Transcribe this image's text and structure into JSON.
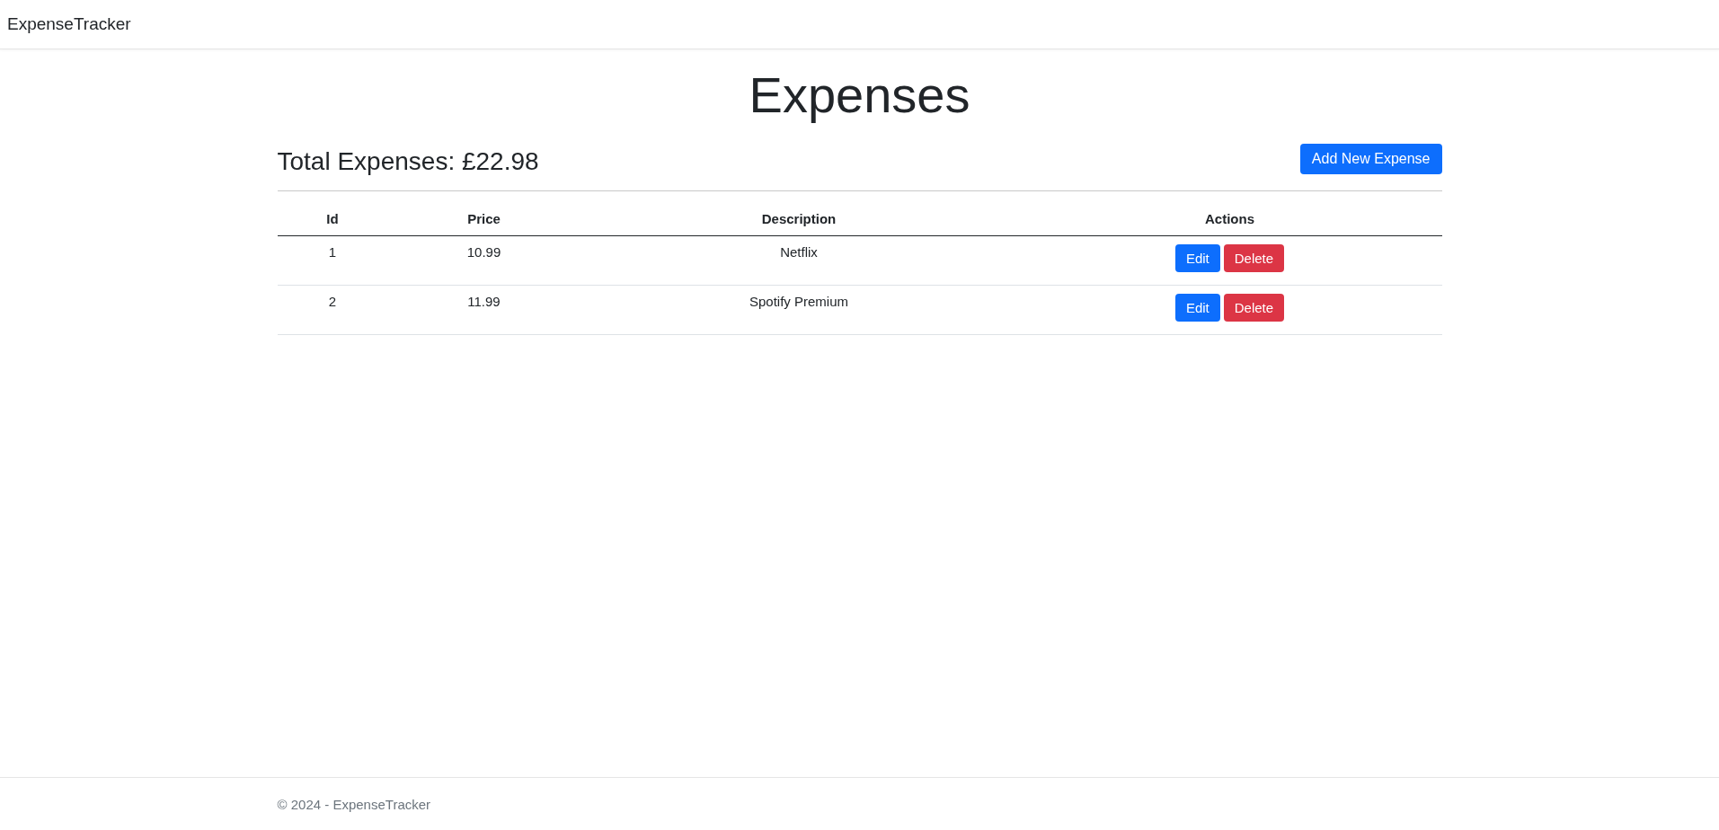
{
  "navbar": {
    "brand": "ExpenseTracker"
  },
  "page": {
    "title": "Expenses",
    "total": "Total Expenses: £22.98",
    "add_button": "Add New Expense"
  },
  "table": {
    "columns": [
      "Id",
      "Price",
      "Description",
      "Actions"
    ],
    "rows": [
      {
        "id": "1",
        "price": "10.99",
        "description": "Netflix",
        "actions": [
          {
            "kind": "edit",
            "label": "Edit"
          },
          {
            "kind": "delete",
            "label": "Delete"
          }
        ]
      },
      {
        "id": "2",
        "price": "11.99",
        "description": "Spotify Premium",
        "actions": [
          {
            "kind": "edit",
            "label": "Edit"
          },
          {
            "kind": "delete",
            "label": "Delete"
          }
        ]
      }
    ]
  },
  "footer": {
    "text": "© 2024 - ExpenseTracker"
  }
}
